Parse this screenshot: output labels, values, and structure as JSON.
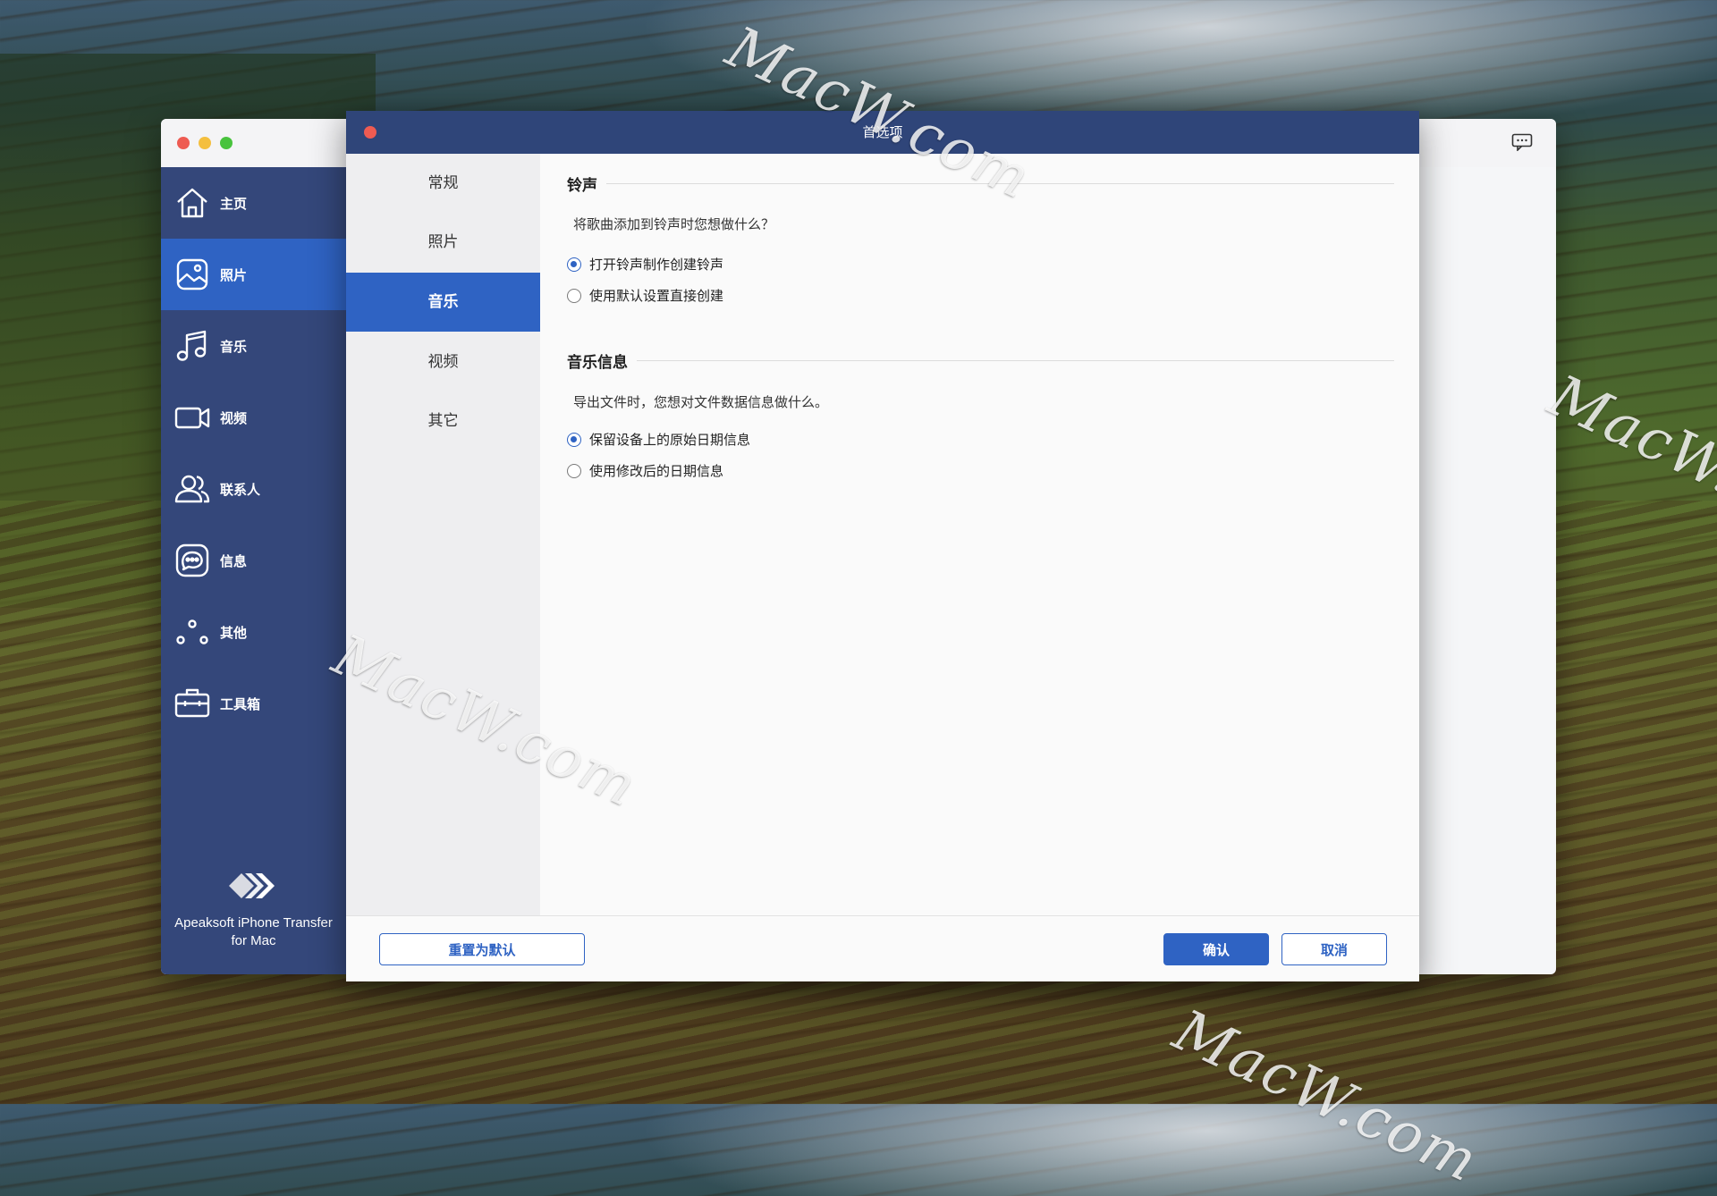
{
  "colors": {
    "accent": "#2f63c3",
    "sidebar": "#34477a",
    "dialog_titlebar": "#2f4579",
    "close": "#ee5b52"
  },
  "watermark": "MacW.com",
  "app": {
    "sidebar": [
      {
        "label": "主页",
        "icon": "home-icon",
        "active": false
      },
      {
        "label": "照片",
        "icon": "photo-icon",
        "active": true
      },
      {
        "label": "音乐",
        "icon": "music-icon",
        "active": false
      },
      {
        "label": "视频",
        "icon": "video-icon",
        "active": false
      },
      {
        "label": "联系人",
        "icon": "contacts-icon",
        "active": false
      },
      {
        "label": "信息",
        "icon": "message-icon",
        "active": false
      },
      {
        "label": "其他",
        "icon": "dots-icon",
        "active": false
      },
      {
        "label": "工具箱",
        "icon": "toolbox-icon",
        "active": false
      }
    ],
    "brand_line1": "Apeaksoft iPhone Transfer",
    "brand_line2": "for Mac"
  },
  "dialog": {
    "title": "首选项",
    "tabs": [
      {
        "label": "常规",
        "active": false
      },
      {
        "label": "照片",
        "active": false
      },
      {
        "label": "音乐",
        "active": true
      },
      {
        "label": "视频",
        "active": false
      },
      {
        "label": "其它",
        "active": false
      }
    ],
    "ringtone": {
      "title": "铃声",
      "question": "将歌曲添加到铃声时您想做什么？",
      "options": [
        {
          "label": "打开铃声制作创建铃声",
          "checked": true
        },
        {
          "label": "使用默认设置直接创建",
          "checked": false
        }
      ]
    },
    "music_info": {
      "title": "音乐信息",
      "question": "导出文件时，您想对文件数据信息做什么。",
      "options": [
        {
          "label": "保留设备上的原始日期信息",
          "checked": true
        },
        {
          "label": "使用修改后的日期信息",
          "checked": false
        }
      ]
    },
    "buttons": {
      "reset": "重置为默认",
      "confirm": "确认",
      "cancel": "取消"
    }
  }
}
